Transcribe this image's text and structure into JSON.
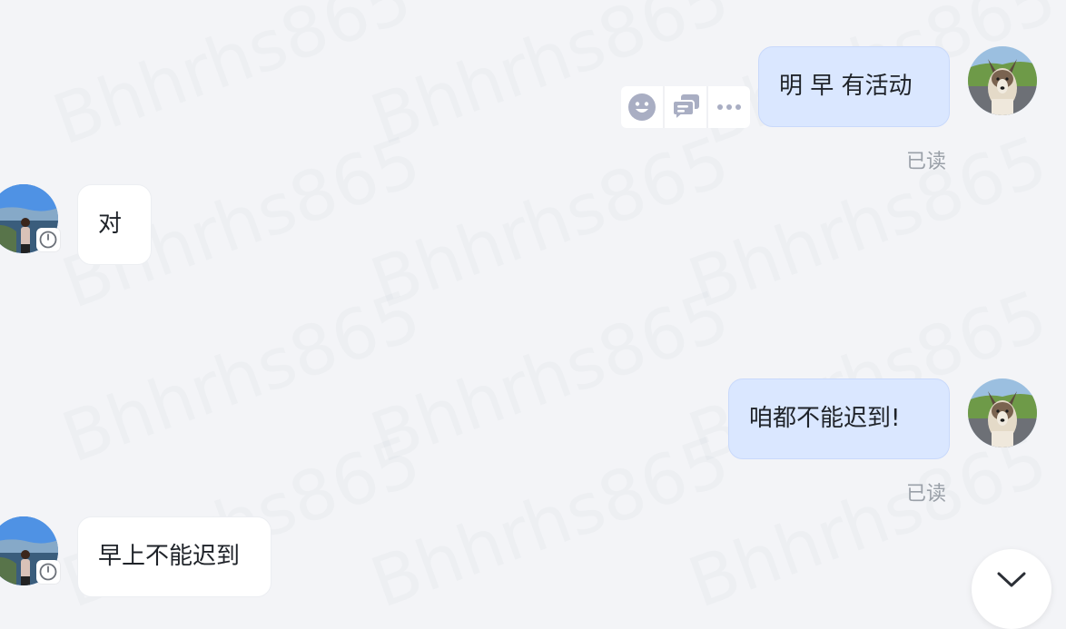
{
  "colors": {
    "background": "#f3f4f7",
    "self_bubble": "#dae7ff",
    "other_bubble": "#ffffff",
    "read_status": "#9aa0a8",
    "action_icon": "#a9aec3"
  },
  "watermark": {
    "text": "Bhhrhs865"
  },
  "messages": [
    {
      "sender": "self",
      "text": "明 早 有活动",
      "read_status": "已读",
      "avatar_icon": "dog-avatar",
      "actions": [
        "emoji-reaction-icon",
        "reply-thread-icon",
        "more-icon"
      ]
    },
    {
      "sender": "other",
      "text": "对",
      "avatar_icon": "person-avatar",
      "badge_icon": "clock-icon"
    },
    {
      "sender": "self",
      "text": "咱都不能迟到!",
      "read_status": "已读",
      "avatar_icon": "dog-avatar"
    },
    {
      "sender": "other",
      "text": "早上不能迟到",
      "avatar_icon": "person-avatar",
      "badge_icon": "clock-icon"
    }
  ],
  "scroll_button": {
    "icon": "chevron-down-icon"
  }
}
